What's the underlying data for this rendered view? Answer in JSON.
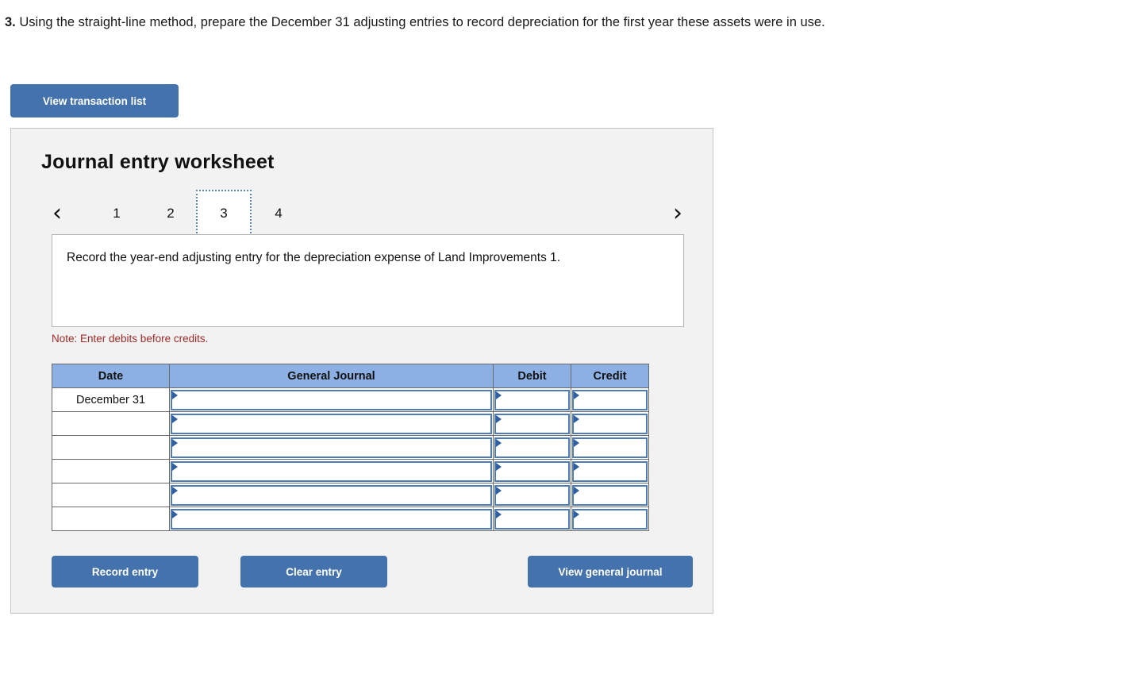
{
  "question": {
    "number": "3.",
    "text": "Using the straight-line method, prepare the December 31 adjusting entries to record depreciation for the first year these assets were in use."
  },
  "toolbar": {
    "view_transaction_list_label": "View transaction list"
  },
  "worksheet": {
    "title": "Journal entry worksheet",
    "pager": {
      "prev_icon": "‹",
      "next_icon": "›",
      "tabs": [
        {
          "label": "1",
          "active": false
        },
        {
          "label": "2",
          "active": false
        },
        {
          "label": "3",
          "active": true
        },
        {
          "label": "4",
          "active": false
        }
      ]
    },
    "description": "Record the year-end adjusting entry for the depreciation expense of Land Improvements 1.",
    "note": "Note: Enter debits before credits.",
    "table": {
      "headers": [
        "Date",
        "General Journal",
        "Debit",
        "Credit"
      ],
      "rows": [
        {
          "date": "December 31",
          "general_journal": "",
          "debit": "",
          "credit": ""
        },
        {
          "date": "",
          "general_journal": "",
          "debit": "",
          "credit": ""
        },
        {
          "date": "",
          "general_journal": "",
          "debit": "",
          "credit": ""
        },
        {
          "date": "",
          "general_journal": "",
          "debit": "",
          "credit": ""
        },
        {
          "date": "",
          "general_journal": "",
          "debit": "",
          "credit": ""
        },
        {
          "date": "",
          "general_journal": "",
          "debit": "",
          "credit": ""
        }
      ]
    },
    "actions": {
      "record_entry_label": "Record entry",
      "clear_entry_label": "Clear entry",
      "view_general_journal_label": "View general journal"
    }
  },
  "colors": {
    "button_blue": "#4472ad",
    "table_header_blue": "#8cb0e3",
    "input_border_blue": "#4e7cb8",
    "note_red": "#9e2a26",
    "panel_bg": "#f2f2f2"
  }
}
